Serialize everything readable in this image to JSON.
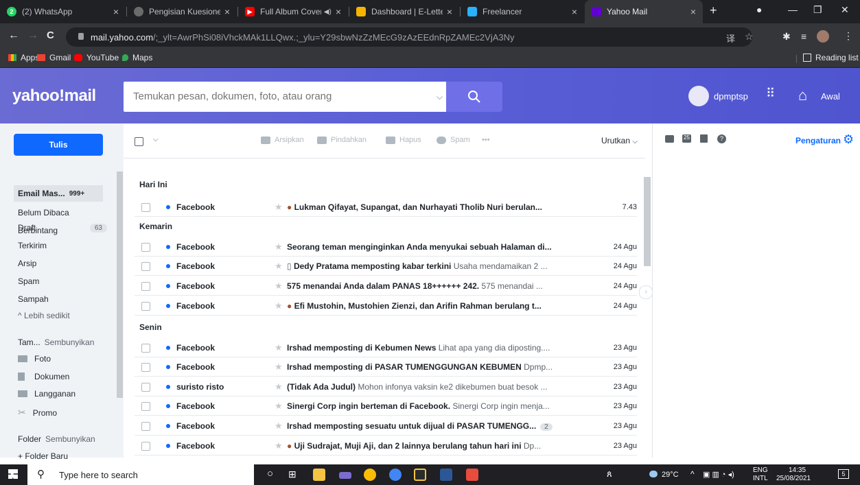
{
  "browser": {
    "tabs": [
      {
        "label": "(2) WhatsApp",
        "color": "#25d366",
        "badge": "2"
      },
      {
        "label": "Pengisian Kuesioner -",
        "color": "#6b6b6b"
      },
      {
        "label": "Full Album Cover",
        "color": "#ff0000"
      },
      {
        "label": "Dashboard | E-Letter",
        "color": "#f4b400"
      },
      {
        "label": "Freelancer",
        "color": "#29b2fe"
      },
      {
        "label": "Yahoo Mail",
        "color": "#6001d2"
      }
    ],
    "url_host": "mail.yahoo.com",
    "url_rest": "/;_ylt=AwrPhSi08iVhckMAk1LLQwx.;_ylu=Y29sbwNzZzMEcG9zAzEEdnRpZAMEc2VjA3Ny",
    "bookmarks": [
      "Apps",
      "Gmail",
      "YouTube",
      "Maps"
    ],
    "reading_list": "Reading list"
  },
  "yahoo": {
    "logo": "yahoo!mail",
    "search_placeholder": "Temukan pesan, dokumen, foto, atau orang",
    "user": "dpmptsp",
    "home": "Awal"
  },
  "nav": {
    "compose": "Tulis",
    "items": [
      {
        "label": "Email Mas...",
        "badge": "999+"
      },
      {
        "label": "Belum Dibaca"
      },
      {
        "label": "Berbintang"
      },
      {
        "label": "Draft",
        "badge": "63"
      },
      {
        "label": "Terkirim"
      },
      {
        "label": "Arsip"
      },
      {
        "label": "Spam"
      },
      {
        "label": "Sampah"
      },
      {
        "label": "^ Lebih sedikit"
      }
    ],
    "views_label": "Tam...",
    "views_hide": "Sembunyikan",
    "views": [
      "Foto",
      "Dokumen",
      "Langganan",
      "Promo"
    ],
    "folders_label": "Folder",
    "folders_hide": "Sembunyikan",
    "new_folder": "+ Folder Baru"
  },
  "toolbar": {
    "archive": "Arsipkan",
    "move": "Pindahkan",
    "delete": "Hapus",
    "spam": "Spam",
    "more": "•••",
    "sort": "Urutkan",
    "settings": "Pengaturan"
  },
  "groups": [
    "Hari Ini",
    "Kemarin",
    "Senin"
  ],
  "emails": [
    {
      "from": "Facebook",
      "subject": "Lukman Qifayat, Supangat, dan Nurhayati Tholib Nuri berulan...",
      "preview": "",
      "date": "7.43"
    },
    {
      "from": "Facebook",
      "subject": "Seorang teman menginginkan Anda menyukai sebuah Halaman di...",
      "preview": "",
      "date": "24 Agu"
    },
    {
      "from": "Facebook",
      "subject": "Dedy Pratama memposting kabar terkini",
      "preview": "Usaha mendamaikan 2 ...",
      "date": "24 Agu"
    },
    {
      "from": "Facebook",
      "subject": "575 menandai Anda dalam PANAS 18++++++ 242.",
      "preview": "575 menandai ...",
      "date": "24 Agu"
    },
    {
      "from": "Facebook",
      "subject": "Efi Mustohin, Mustohien Zienzi, dan Arifin Rahman berulang t...",
      "preview": "",
      "date": "24 Agu"
    },
    {
      "from": "Facebook",
      "subject": "Irshad memposting di Kebumen News",
      "preview": "Lihat apa yang dia diposting....",
      "date": "23 Agu"
    },
    {
      "from": "Facebook",
      "subject": "Irshad memposting di PASAR TUMENGGUNGAN KEBUMEN",
      "preview": "Dpmp...",
      "date": "23 Agu"
    },
    {
      "from": "suristo risto",
      "subject": "(Tidak Ada Judul)",
      "preview": "Mohon infonya vaksin ke2 dikebumen buat besok ...",
      "date": "23 Agu"
    },
    {
      "from": "Facebook",
      "subject": "Sinergi Corp ingin berteman di Facebook.",
      "preview": "Sinergi Corp ingin menja...",
      "date": "23 Agu"
    },
    {
      "from": "Facebook",
      "subject": "Irshad memposting sesuatu untuk dijual di PASAR TUMENGG...",
      "preview": "",
      "count": "2",
      "date": "23 Agu"
    },
    {
      "from": "Facebook",
      "subject": "Uji Sudrajat, Muji Aji, dan 2 lainnya berulang tahun hari ini",
      "preview": "Dp...",
      "date": "23 Agu"
    }
  ],
  "taskbar": {
    "search": "Type here to search",
    "temp": "29°C",
    "lang1": "ENG",
    "lang2": "INTL",
    "time": "14:35",
    "date": "25/08/2021",
    "notif": "5"
  }
}
